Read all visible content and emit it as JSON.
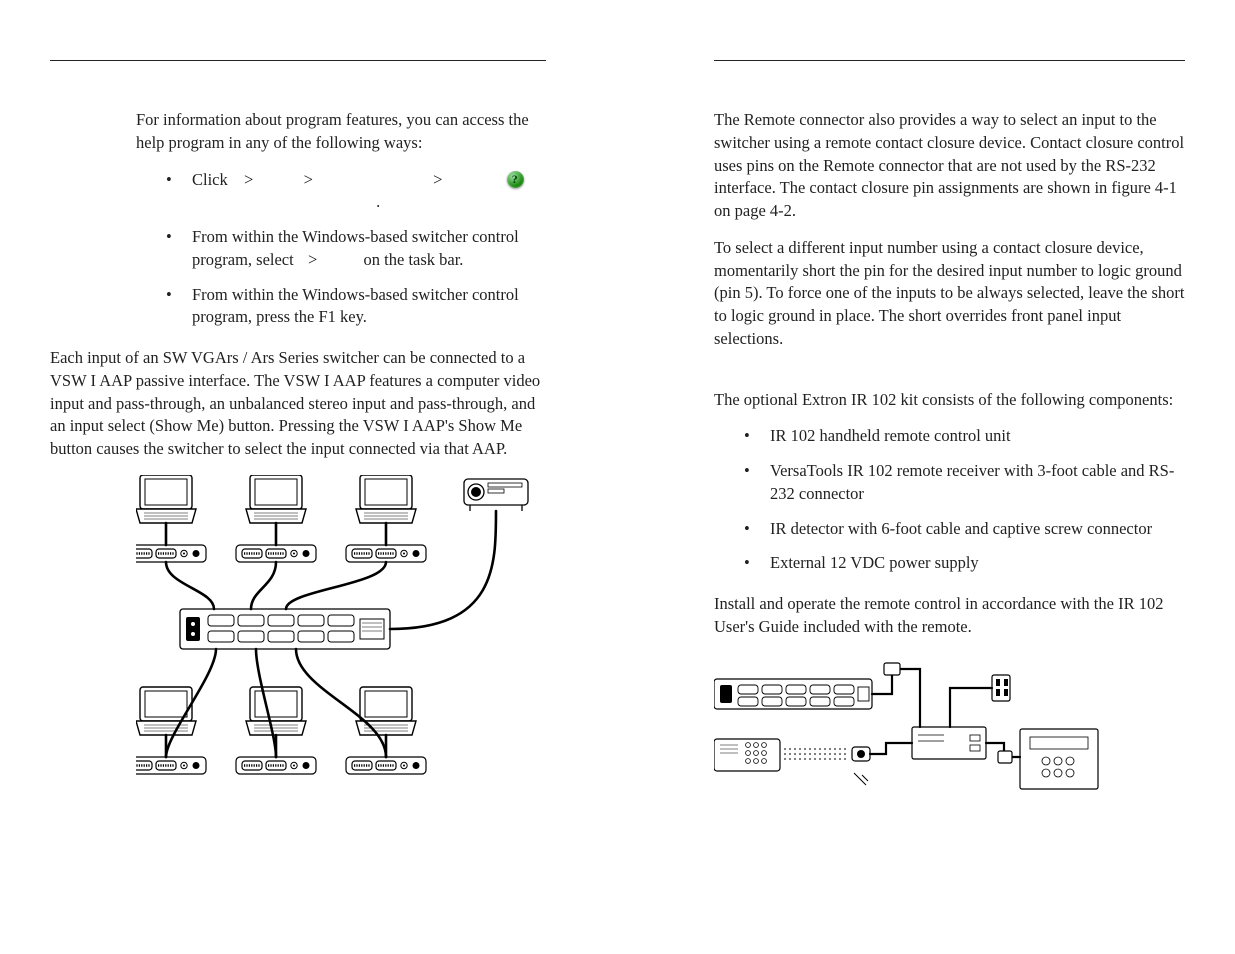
{
  "left": {
    "intro": "For information about program features, you can access the help program in any of the following ways:",
    "click_path": {
      "word_click": "Click",
      "gt": ">",
      "period": "."
    },
    "bullet2a": "From within the Windows-based switcher control program, select",
    "bullet2b": "on the task bar.",
    "bullet3": "From within the Windows-based switcher control program, press the F1 key.",
    "vsw_para": "Each input of an SW VGArs / Ars Series switcher can be connected to a VSW I AAP passive interface.  The VSW I AAP features a computer video input and pass-through, an unbalanced stereo input and pass-through, and an input select (Show Me) button.  Pressing the VSW I AAP's Show Me button causes the switcher to select the input connected via that AAP."
  },
  "right": {
    "remote_para": "The Remote connector also provides a way to select an input to the switcher using a remote contact closure device.  Contact closure control uses pins on the Remote connector that are not used by the RS-232 interface.  The contact closure pin assignments are shown in figure 4-1 on page 4-2.",
    "select_para": "To select a different input number using a contact closure device, momentarily short the pin for the desired input number to logic ground (pin 5).  To force one of the inputs to be always selected, leave the short to logic ground in place.  The short overrides front panel input selections.",
    "ir_intro": "The optional Extron IR 102 kit consists of the following components:",
    "ir_list": [
      "IR 102 handheld remote control unit",
      "VersaTools IR 102 remote receiver with 3-foot cable and RS-232 connector",
      "IR detector with 6-foot cable and captive screw connector",
      "External 12 VDC power supply"
    ],
    "ir_outro": "Install and operate the remote control in accordance with the IR 102 User's Guide included with the remote."
  }
}
